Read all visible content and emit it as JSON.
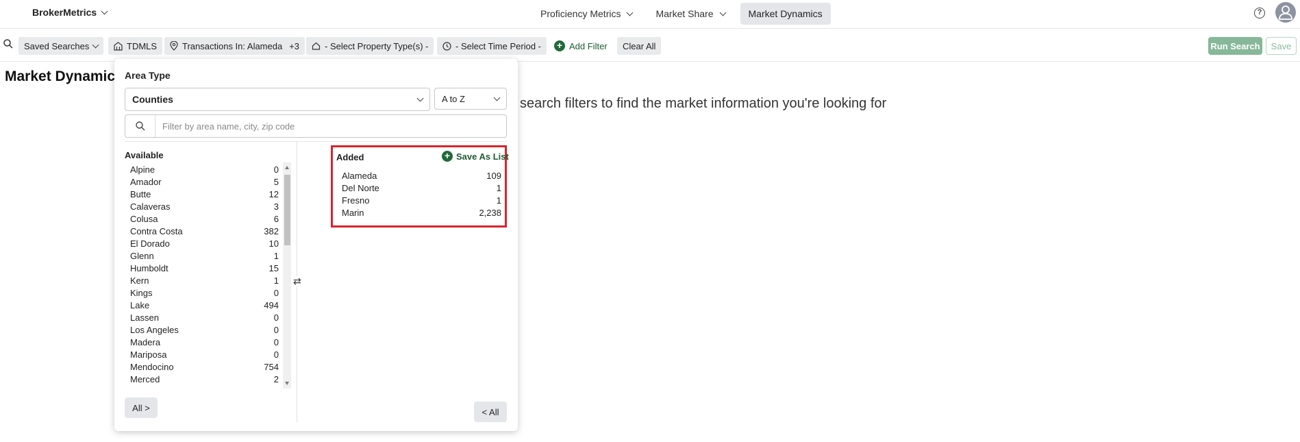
{
  "header": {
    "brand": "BrokerMetrics",
    "nav": [
      {
        "label": "Proficiency Metrics"
      },
      {
        "label": "Market Share"
      },
      {
        "label": "Market Dynamics"
      }
    ],
    "help_icon": "?"
  },
  "filterbar": {
    "saved_searches": "Saved Searches",
    "mls": "TDMLS",
    "transactions": "Transactions In: Alameda",
    "transactions_extra": "+3",
    "property_type": "- Select Property Type(s) -",
    "time_period": "- Select Time Period -",
    "add_filter": "Add Filter",
    "clear_all": "Clear All",
    "run_search": "Run Search",
    "save": "Save"
  },
  "page": {
    "title": "Market Dynamics",
    "hint": "search filters to find the market information you're looking for"
  },
  "panel": {
    "area_type_label": "Area Type",
    "area_type_value": "Counties",
    "sort_value": "A to Z",
    "filter_placeholder": "Filter by area name, city, zip code",
    "available_title": "Available",
    "available": [
      {
        "name": "Alpine",
        "count": "0"
      },
      {
        "name": "Amador",
        "count": "5"
      },
      {
        "name": "Butte",
        "count": "12"
      },
      {
        "name": "Calaveras",
        "count": "3"
      },
      {
        "name": "Colusa",
        "count": "6"
      },
      {
        "name": "Contra Costa",
        "count": "382"
      },
      {
        "name": "El Dorado",
        "count": "10"
      },
      {
        "name": "Glenn",
        "count": "1"
      },
      {
        "name": "Humboldt",
        "count": "15"
      },
      {
        "name": "Kern",
        "count": "1"
      },
      {
        "name": "Kings",
        "count": "0"
      },
      {
        "name": "Lake",
        "count": "494"
      },
      {
        "name": "Lassen",
        "count": "0"
      },
      {
        "name": "Los Angeles",
        "count": "0"
      },
      {
        "name": "Madera",
        "count": "0"
      },
      {
        "name": "Mariposa",
        "count": "0"
      },
      {
        "name": "Mendocino",
        "count": "754"
      },
      {
        "name": "Merced",
        "count": "2"
      }
    ],
    "added_title": "Added",
    "save_as_list": "Save As List",
    "added": [
      {
        "name": "Alameda",
        "count": "109"
      },
      {
        "name": "Del Norte",
        "count": "1"
      },
      {
        "name": "Fresno",
        "count": "1"
      },
      {
        "name": "Marin",
        "count": "2,238"
      }
    ],
    "all_button": "All >",
    "back_all_button": "< All",
    "swap_icon": "⇄"
  },
  "colors": {
    "accent_green": "#1f6a3a",
    "run_search_bg": "#86b899",
    "highlight_red": "#d9232d"
  }
}
